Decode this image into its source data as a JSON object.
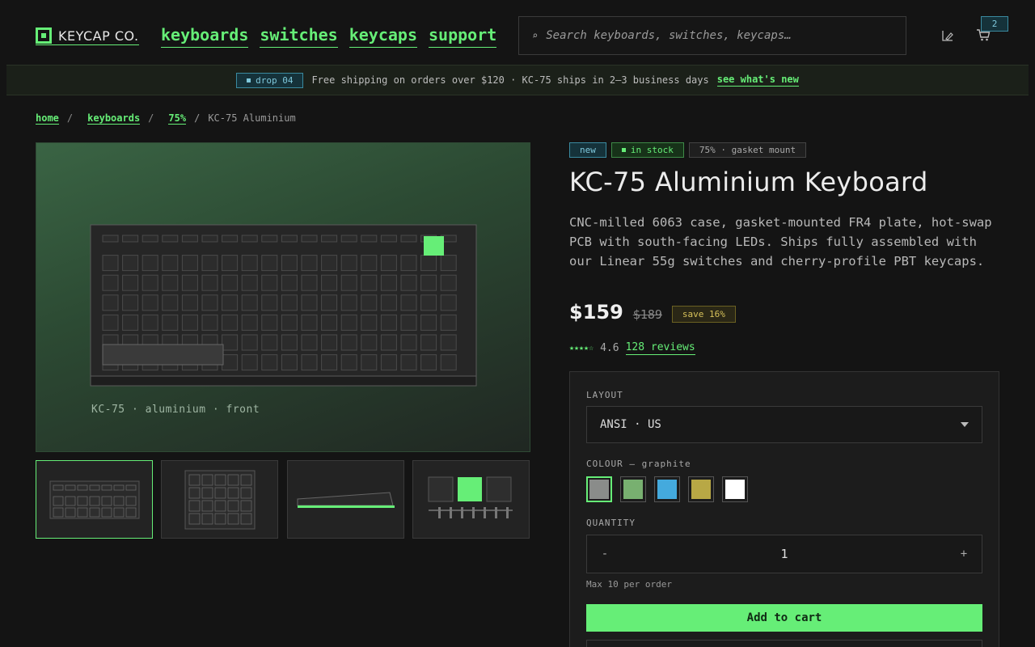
{
  "brand": {
    "name": "KEYCAP CO."
  },
  "nav": [
    {
      "label": "keyboards"
    },
    {
      "label": "switches"
    },
    {
      "label": "keycaps"
    },
    {
      "label": "support"
    }
  ],
  "search": {
    "placeholder": "Search keyboards, switches, keycaps…",
    "icon": "search-icon"
  },
  "cart": {
    "count": "2"
  },
  "promo": {
    "badge": "drop 04",
    "text": "Free shipping on orders over $120 · KC-75 ships in 2–3 business days",
    "link": "see what's new"
  },
  "breadcrumb": {
    "items": [
      "home",
      "keyboards",
      "75%"
    ],
    "separator": "/",
    "current": "KC-75 Aluminium"
  },
  "gallery": {
    "caption": "KC-75 · aluminium · front",
    "accent": "#66ee77"
  },
  "product": {
    "tags": {
      "new": "new",
      "stock": "in stock",
      "layout": "75% · gasket mount"
    },
    "title": "KC-75 Aluminium Keyboard",
    "description": "CNC-milled 6063 case, gasket-mounted FR4 plate, hot-swap PCB with south-facing LEDs. Ships fully assembled with our Linear 55g switches and cherry-profile PBT keycaps.",
    "price": "$159",
    "old_price": "$189",
    "save": "save 16%",
    "stars": "★★★★☆",
    "rating": "4.6",
    "reviews": "128 reviews"
  },
  "config": {
    "layout_label": "LAYOUT",
    "layout_value": "ANSI · US",
    "colour_label": "COLOUR — graphite",
    "swatches": [
      {
        "name": "graphite",
        "color": "#8a8c8a"
      },
      {
        "name": "sage",
        "color": "#78b070"
      },
      {
        "name": "sky",
        "color": "#44aadd"
      },
      {
        "name": "mustard",
        "color": "#b8a845"
      },
      {
        "name": "white",
        "color": "#ffffff"
      }
    ],
    "quantity_label": "QUANTITY",
    "minus": "-",
    "quantity": "1",
    "plus": "+",
    "max_note": "Max 10 per order",
    "add_to_cart": "Add to cart"
  }
}
